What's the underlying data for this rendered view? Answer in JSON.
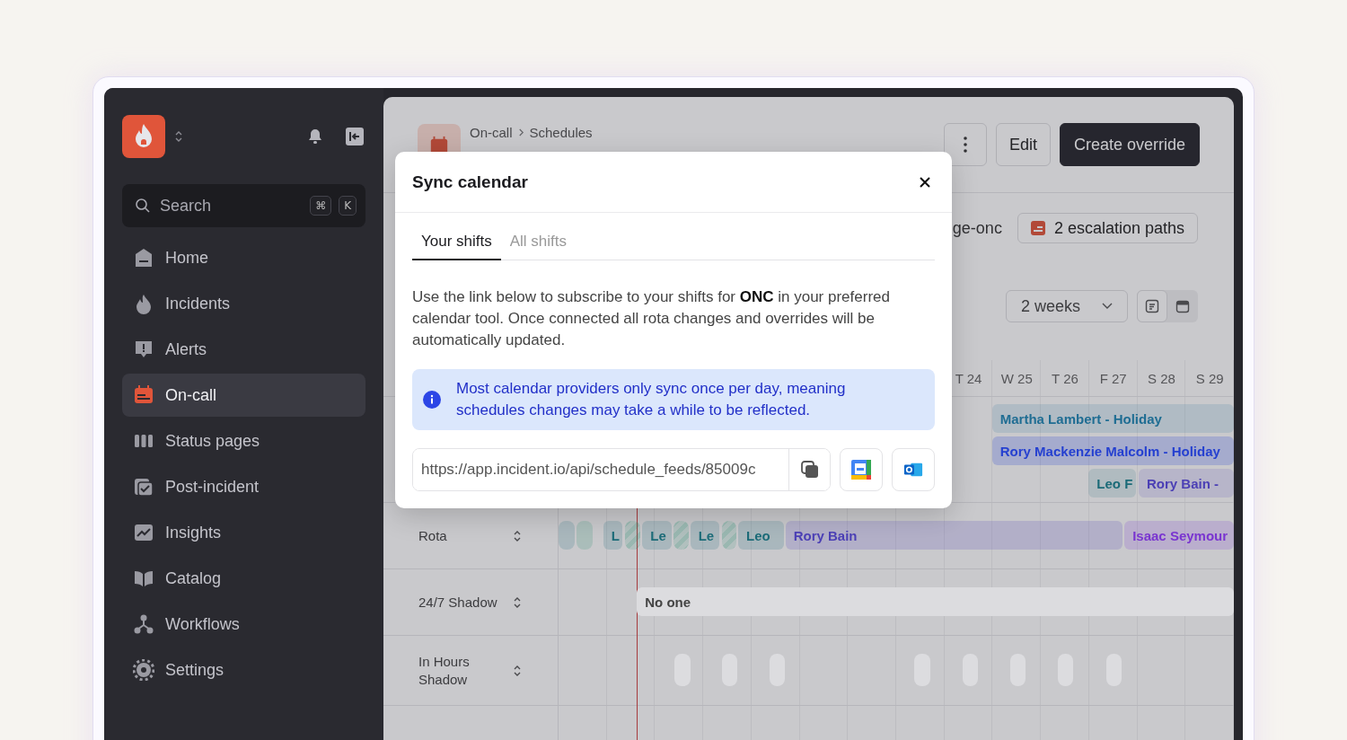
{
  "sidebar": {
    "search": {
      "placeholder": "Search",
      "keys": [
        "⌘",
        "K"
      ]
    },
    "items": [
      {
        "label": "Home",
        "selected": false
      },
      {
        "label": "Incidents",
        "selected": false
      },
      {
        "label": "Alerts",
        "selected": false
      },
      {
        "label": "On-call",
        "selected": true
      },
      {
        "label": "Status pages",
        "selected": false
      },
      {
        "label": "Post-incident",
        "selected": false
      },
      {
        "label": "Insights",
        "selected": false
      },
      {
        "label": "Catalog",
        "selected": false
      },
      {
        "label": "Workflows",
        "selected": false
      },
      {
        "label": "Settings",
        "selected": false
      }
    ]
  },
  "header": {
    "breadcrumb": [
      "On-call",
      "Schedules"
    ],
    "actions": [
      {
        "kind": "more"
      },
      {
        "kind": "secondary",
        "label": "Edit"
      },
      {
        "kind": "primary",
        "label": "Create override"
      }
    ]
  },
  "meta": {
    "link": "ge-onc",
    "escalation": "2 escalation paths"
  },
  "view": {
    "range": "2 weeks",
    "modes": [
      {
        "kind": "list",
        "selected": true
      },
      {
        "kind": "calendar",
        "selected": false
      }
    ]
  },
  "timeline": {
    "days": [
      "T 24",
      "W 25",
      "T 26",
      "F 27",
      "S 28",
      "S 29"
    ],
    "overrides": [
      {
        "label": "Martha Lambert - Holiday"
      },
      {
        "label": "Rory Mackenzie Malcolm - Holiday"
      },
      {
        "label": "Leo F"
      },
      {
        "label": "Rory Bain -"
      }
    ],
    "rows": [
      {
        "label": "Rota",
        "shifts": [
          {
            "kind": "plain"
          },
          {
            "kind": "plain"
          },
          {
            "kind": "plain",
            "label": "L"
          },
          {
            "kind": "hatched"
          },
          {
            "kind": "plain",
            "label": "Le"
          },
          {
            "kind": "hatched"
          },
          {
            "kind": "plain",
            "label": "Le"
          },
          {
            "kind": "hatched"
          },
          {
            "kind": "plain",
            "label": "Leo"
          },
          {
            "kind": "plain",
            "label": "Rory Bain"
          },
          {
            "kind": "plain",
            "label": "Isaac Seymour"
          }
        ]
      },
      {
        "label": "24/7 Shadow",
        "shifts": [
          {
            "kind": "empty",
            "label": "No one"
          }
        ]
      },
      {
        "label": "In Hours Shadow",
        "shifts": [
          {
            "kind": "empty"
          },
          {
            "kind": "empty"
          },
          {
            "kind": "empty"
          },
          {
            "kind": "empty"
          },
          {
            "kind": "empty"
          },
          {
            "kind": "empty"
          },
          {
            "kind": "empty"
          },
          {
            "kind": "empty"
          }
        ]
      }
    ]
  },
  "modal": {
    "title": "Sync calendar",
    "tabs": [
      {
        "label": "Your shifts",
        "selected": true
      },
      {
        "label": "All shifts",
        "selected": false
      }
    ],
    "description": "Use the link below to subscribe to your shifts for **ONC** in your preferred calendar tool. Once connected all rota changes and overrides will be automatically updated.",
    "notice": "Most calendar providers only sync once per day, meaning schedules changes may take a while to be reflected.",
    "url": "https://app.incident.io/api/schedule_feeds/85009c"
  }
}
